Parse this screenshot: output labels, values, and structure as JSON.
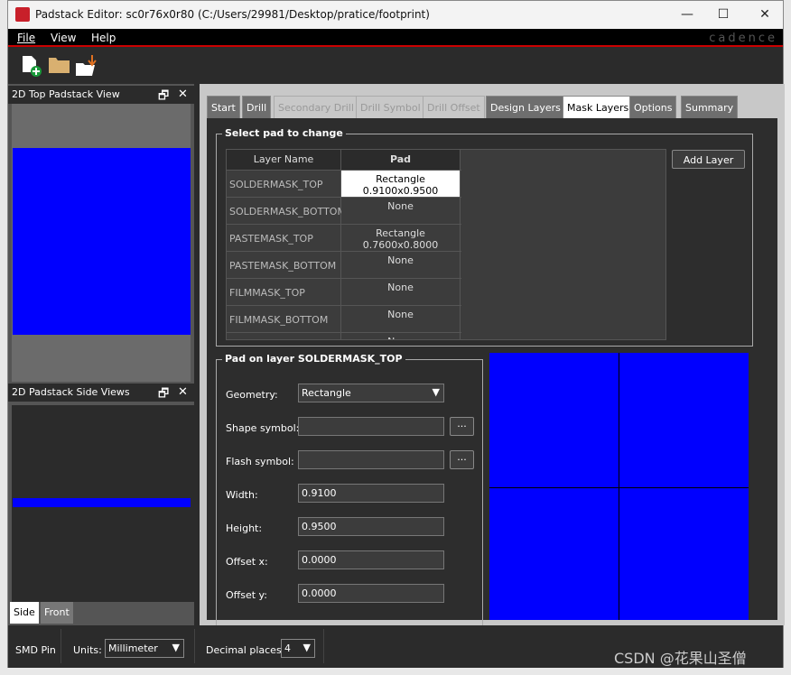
{
  "window": {
    "title": "Padstack Editor: sc0r76x0r80  (C:/Users/29981/Desktop/pratice/footprint)",
    "minimize": "—",
    "maximize": "☐",
    "close": "✕",
    "brand": "cadence"
  },
  "menu": [
    {
      "label": "File"
    },
    {
      "label": "View"
    },
    {
      "label": "Help"
    }
  ],
  "toolbar": {
    "icons": [
      "new-file-icon",
      "open-folder-icon",
      "import-folder-icon"
    ]
  },
  "left": {
    "top_view_title": "2D Top Padstack View",
    "side_view_title": "2D Padstack Side Views",
    "float": "🗗",
    "close": "✕",
    "side_tabs": [
      {
        "label": "Side"
      },
      {
        "label": "Front"
      }
    ]
  },
  "tabs": [
    {
      "label": "Start"
    },
    {
      "label": "Drill"
    },
    {
      "label": "Secondary Drill"
    },
    {
      "label": "Drill Symbol"
    },
    {
      "label": "Drill Offset"
    },
    {
      "label": "Design Layers"
    },
    {
      "label": "Mask Layers"
    },
    {
      "label": "Options"
    },
    {
      "label": "Summary"
    }
  ],
  "select_pad": {
    "title": "Select pad to change",
    "headers": [
      "Layer Name",
      "Pad"
    ],
    "rows": [
      {
        "layer": "SOLDERMASK_TOP",
        "pad": "Rectangle 0.9100x0.9500"
      },
      {
        "layer": "SOLDERMASK_BOTTOM",
        "pad": "None"
      },
      {
        "layer": "PASTEMASK_TOP",
        "pad": "Rectangle 0.7600x0.8000"
      },
      {
        "layer": "PASTEMASK_BOTTOM",
        "pad": "None"
      },
      {
        "layer": "FILMMASK_TOP",
        "pad": "None"
      },
      {
        "layer": "FILMMASK_BOTTOM",
        "pad": "None"
      },
      {
        "layer": "",
        "pad": "None"
      }
    ],
    "add_layer": "Add Layer"
  },
  "pad_layer": {
    "title": "Pad on layer SOLDERMASK_TOP",
    "geometry_label": "Geometry:",
    "geometry": "Rectangle",
    "shape_label": "Shape symbol:",
    "shape": "",
    "flash_label": "Flash symbol:",
    "flash": "",
    "browse": "...",
    "width_label": "Width:",
    "width": "0.9100",
    "height_label": "Height:",
    "height": "0.9500",
    "offx_label": "Offset x:",
    "offx": "0.0000",
    "offy_label": "Offset y:",
    "offy": "0.0000"
  },
  "status": {
    "pin_type": "SMD Pin",
    "units_label": "Units:",
    "units": "Millimeter",
    "decimal_label": "Decimal places:",
    "decimal": "4"
  },
  "watermark": "CSDN @花果山圣僧",
  "colors": {
    "pad": "#0000ff",
    "accent": "#cc0000"
  }
}
